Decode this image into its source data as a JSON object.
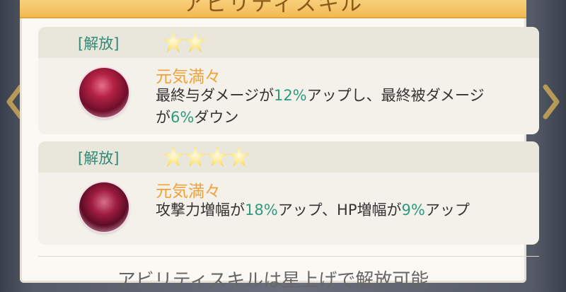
{
  "header": {
    "title": "アビリティスキル"
  },
  "skills": [
    {
      "status": "[解放]",
      "stars": 2,
      "name": "元気満々",
      "desc_lines": [
        [
          {
            "t": "最終与ダメージが"
          },
          {
            "t": "12%",
            "hl": true
          },
          {
            "t": "アップし、最終被ダメージ"
          }
        ],
        [
          {
            "t": "が"
          },
          {
            "t": "6%",
            "hl": true
          },
          {
            "t": "ダウン"
          }
        ]
      ]
    },
    {
      "status": "[解放]",
      "stars": 4,
      "name": "元気満々",
      "desc_lines": [
        [
          {
            "t": "攻撃力増幅が"
          },
          {
            "t": "18%",
            "hl": true
          },
          {
            "t": "アップ、HP増幅が"
          },
          {
            "t": "9%",
            "hl": true
          },
          {
            "t": "アップ"
          }
        ]
      ]
    }
  ],
  "footer": {
    "text": "アビリティスキルは星上げで解放可能"
  },
  "icons": {
    "left_nav": "chevron-left-icon",
    "right_nav": "chevron-right-icon",
    "star": "star-icon",
    "skill": "skill-emblem-icon"
  },
  "colors": {
    "header": "#f2bb55",
    "status": "#2f8a78",
    "skill_name": "#f0a23a",
    "highlight": "#2f9a7e",
    "star": "#f3c33b"
  }
}
